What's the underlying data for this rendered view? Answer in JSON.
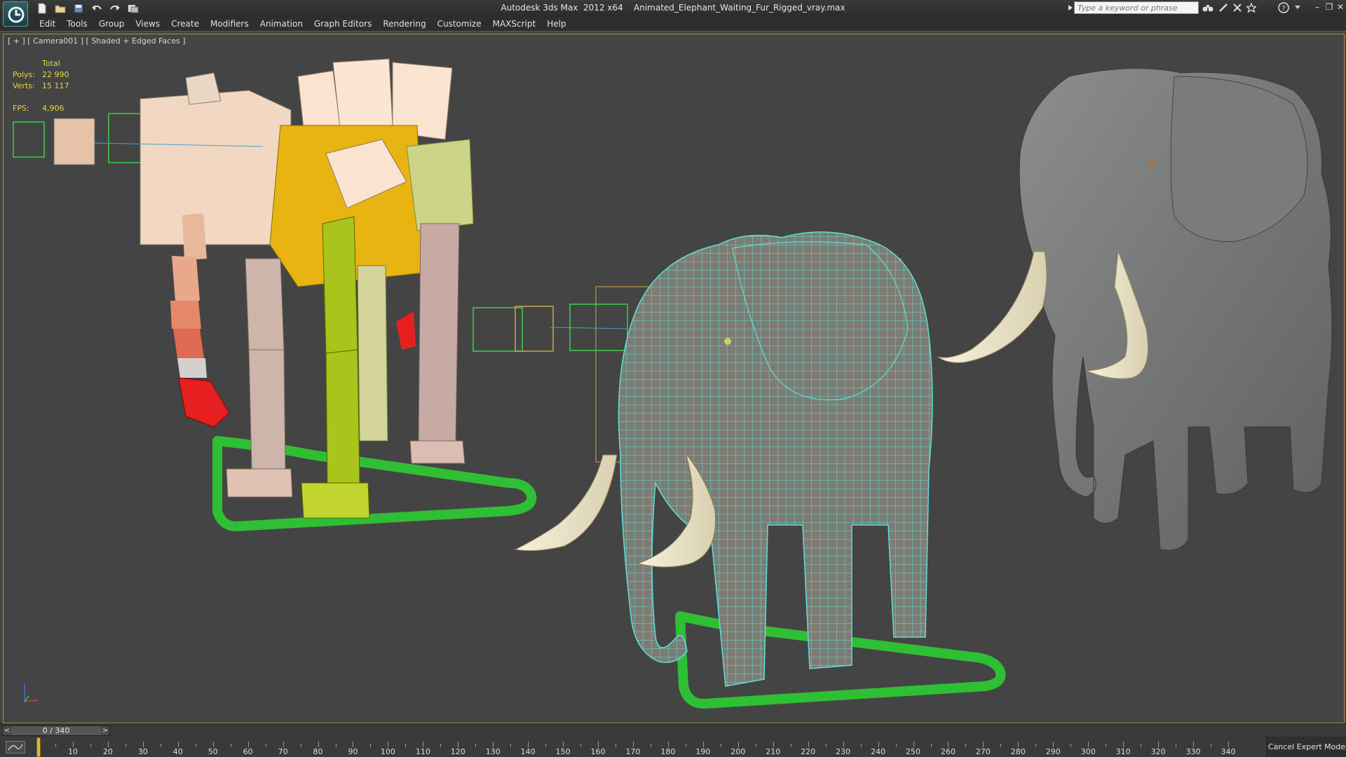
{
  "titlebar": {
    "app_title": "Autodesk 3ds Max  2012 x64",
    "file_name": "Animated_Elephant_Waiting_Fur_Rigged_vray.max",
    "search_placeholder": "Type a keyword or phrase",
    "window_controls": [
      "minimize",
      "restore",
      "close"
    ]
  },
  "quick_access": [
    "new-icon",
    "open-icon",
    "save-icon",
    "undo-icon",
    "redo-icon",
    "project-folder-icon"
  ],
  "menubar": {
    "items": [
      "Edit",
      "Tools",
      "Group",
      "Views",
      "Create",
      "Modifiers",
      "Animation",
      "Graph Editors",
      "Rendering",
      "Customize",
      "MAXScript",
      "Help"
    ]
  },
  "viewport": {
    "label": "[ + ] [ Camera001 ] [ Shaded + Edged Faces ]",
    "stats": {
      "header": "Total",
      "polys_label": "Polys:",
      "polys_value": "22 990",
      "verts_label": "Verts:",
      "verts_value": "15 117",
      "fps_label": "FPS:",
      "fps_value": "4,906"
    }
  },
  "timeline": {
    "slider_text": "0 / 340",
    "current_frame": 0,
    "total_frames": 340,
    "tick_labels": [
      "10",
      "20",
      "30",
      "40",
      "50",
      "60",
      "70",
      "80",
      "90",
      "100",
      "110",
      "120",
      "130",
      "140",
      "150",
      "160",
      "170",
      "180",
      "190",
      "200",
      "210",
      "220",
      "230",
      "240",
      "250",
      "260",
      "270",
      "280",
      "290",
      "300",
      "310",
      "320",
      "330",
      "340"
    ],
    "prev_label": "<",
    "next_label": ">"
  },
  "status": {
    "cancel_expert_mode": "Cancel Expert Mode"
  },
  "colors": {
    "viewport_bg": "#444444",
    "stats_text": "#e8d442",
    "active_border": "#a8953a",
    "wire": "#5fe0d8"
  }
}
